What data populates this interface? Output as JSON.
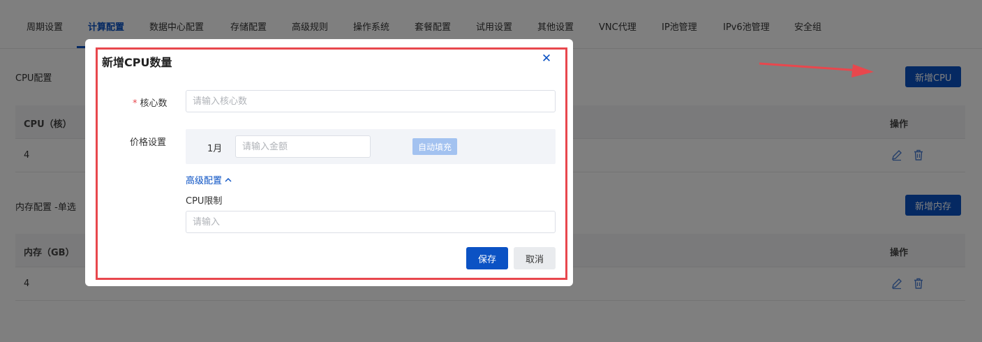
{
  "tabs": [
    {
      "label": "周期设置"
    },
    {
      "label": "计算配置"
    },
    {
      "label": "数据中心配置"
    },
    {
      "label": "存储配置"
    },
    {
      "label": "高级规则"
    },
    {
      "label": "操作系统"
    },
    {
      "label": "套餐配置"
    },
    {
      "label": "试用设置"
    },
    {
      "label": "其他设置"
    },
    {
      "label": "VNC代理"
    },
    {
      "label": "IP池管理"
    },
    {
      "label": "IPv6池管理"
    },
    {
      "label": "安全组"
    }
  ],
  "active_tab": "计算配置",
  "cpu_section": {
    "title": "CPU配置",
    "add_button": "新增CPU",
    "columns": [
      "CPU（核）",
      "操作"
    ],
    "rows": [
      {
        "cpu": "4"
      }
    ]
  },
  "memory_section": {
    "title": "内存配置 -单选",
    "add_button": "新增内存",
    "columns": [
      "内存（GB）",
      "操作"
    ],
    "rows": [
      {
        "memory": "4"
      }
    ]
  },
  "dialog": {
    "title": "新增CPU数量",
    "close_icon": "close-icon",
    "core_label": "核心数",
    "required_mark": "*",
    "core_placeholder": "请输入核心数",
    "core_value": "",
    "price_label": "价格设置",
    "price_period": "1月",
    "price_placeholder": "请输入金额",
    "price_value": "",
    "autofill_button": "自动填充",
    "advanced_toggle": "高级配置",
    "cpu_limit_label": "CPU限制",
    "cpu_limit_placeholder": "请输入",
    "cpu_limit_value": "",
    "save_button": "保存",
    "cancel_button": "取消"
  },
  "colors": {
    "primary": "#0b52c4",
    "highlight_border": "#e8474d",
    "autofill_disabled": "#a3c2f0",
    "mask": "rgba(0,0,0,0.5)"
  }
}
